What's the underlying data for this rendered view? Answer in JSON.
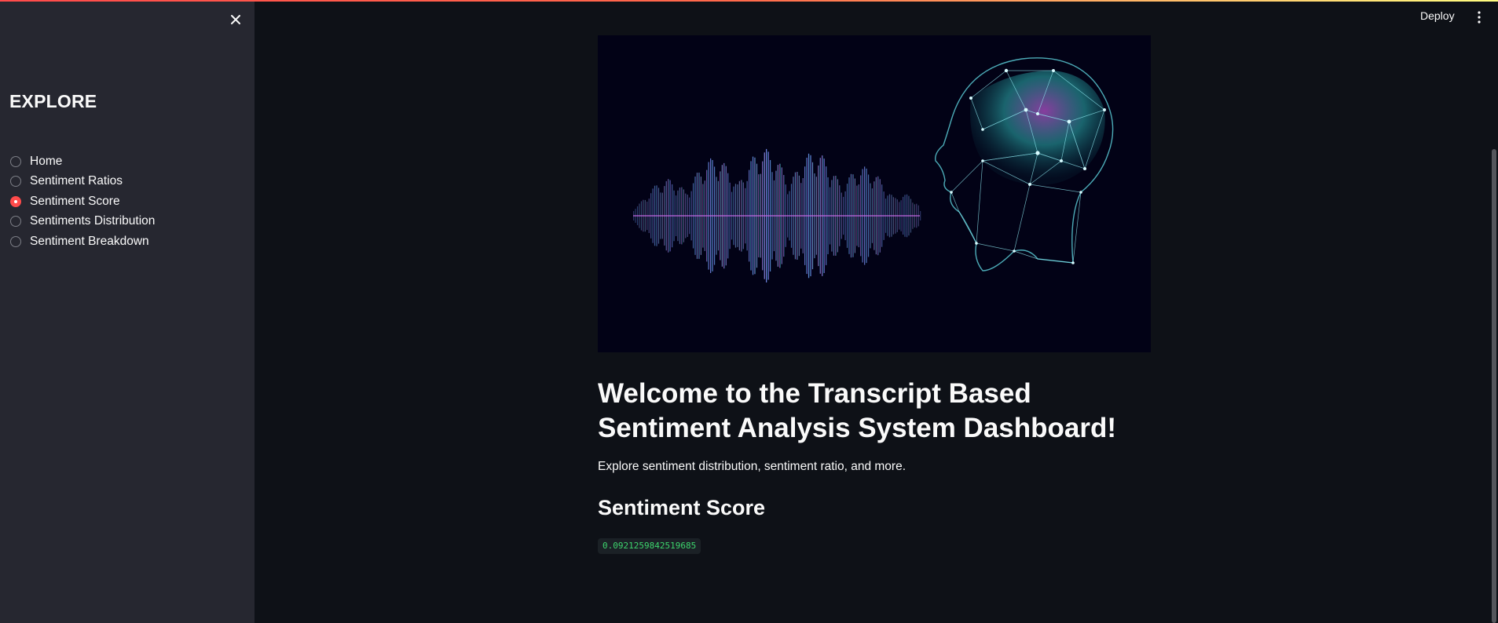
{
  "sidebar": {
    "title": "EXPLORE",
    "nav_items": [
      {
        "label": "Home",
        "selected": false
      },
      {
        "label": "Sentiment Ratios",
        "selected": false
      },
      {
        "label": "Sentiment Score",
        "selected": true
      },
      {
        "label": "Sentiments Distribution",
        "selected": false
      },
      {
        "label": "Sentiment Breakdown",
        "selected": false
      }
    ],
    "close_icon": "close-icon"
  },
  "header": {
    "deploy_label": "Deploy",
    "menu_icon": "more-vertical-icon"
  },
  "main": {
    "hero_image": "sound-wave-brain-illustration",
    "heading": "Welcome to the Transcript Based Sentiment Analysis System Dashboard!",
    "intro": "Explore sentiment distribution, sentiment ratio, and more.",
    "section_title": "Sentiment Score",
    "score_value": "0.0921259842519685"
  },
  "colors": {
    "accent": "#ff4b4b",
    "sidebar_bg": "#262730",
    "main_bg": "#0e1117",
    "code_text": "#3dd56d"
  }
}
